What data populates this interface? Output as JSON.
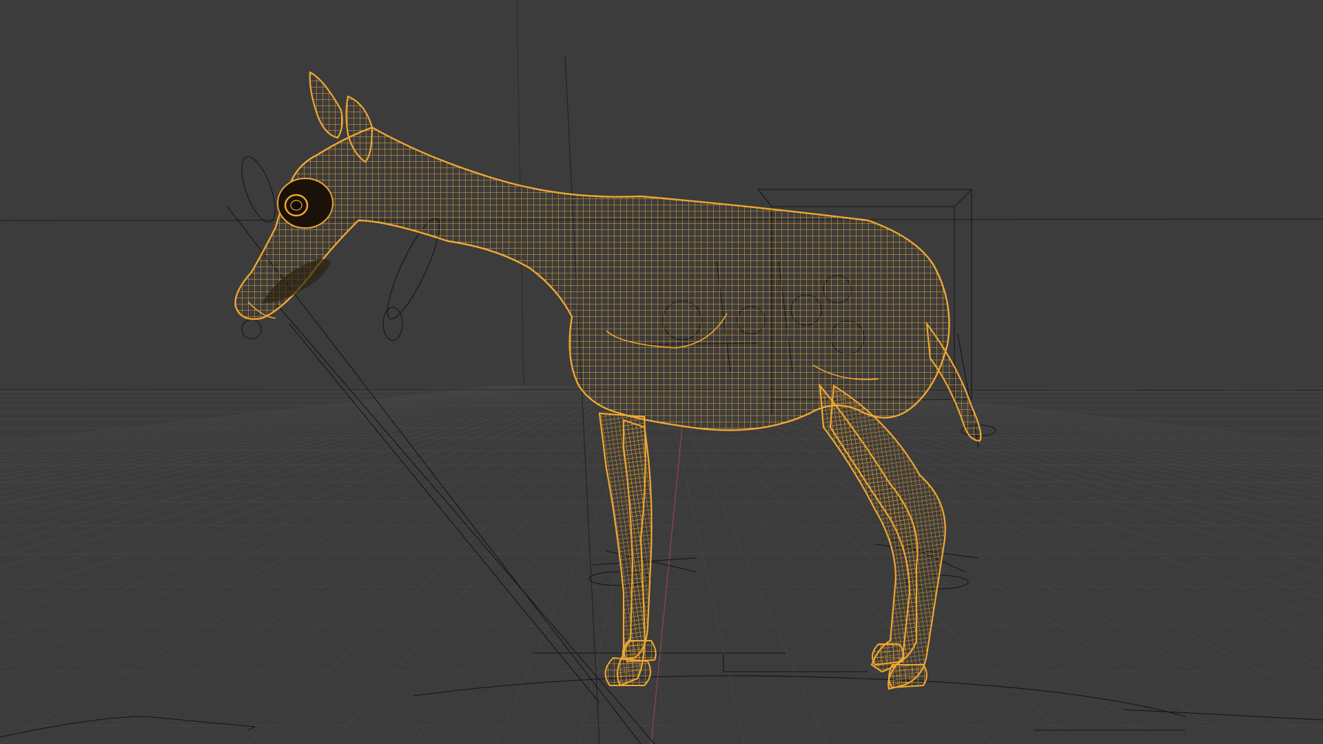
{
  "viewport": {
    "background_color": "#3c3c3c",
    "grid_color": "#454545",
    "grid_major_color": "#2a2a2a",
    "horizon_line_color": "#222222",
    "wire_selected_color": "#f0a830",
    "wire_secondary_color": "#d99320",
    "rig_color": "#151515",
    "z_axis_color": "#b04050",
    "eye_fill_color": "#1a1208"
  },
  "scene": {
    "object": "wireframe-giraffe-model",
    "mode": "wireframe"
  }
}
